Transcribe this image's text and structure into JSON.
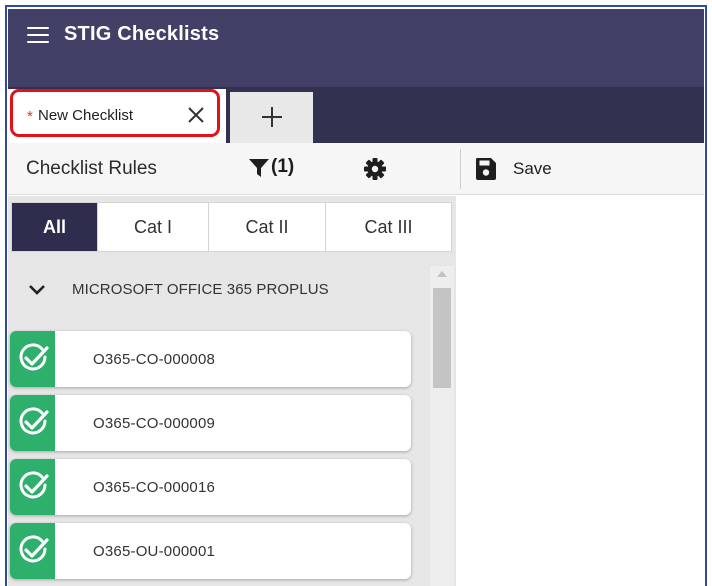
{
  "header": {
    "title": "STIG Checklists",
    "menu_icon": "hamburger-menu-icon",
    "background": "#434068"
  },
  "tabs": {
    "active": {
      "modified_marker": "*",
      "label": "New Checklist",
      "close_icon": "close-icon"
    },
    "add_icon": "plus-icon"
  },
  "toolbar": {
    "title": "Checklist Rules",
    "filter_icon": "filter-icon",
    "filter_count": "(1)",
    "settings_icon": "gear-icon",
    "save_icon": "floppy-disk-icon",
    "save_label": "Save"
  },
  "category_tabs": [
    {
      "label": "All",
      "active": true
    },
    {
      "label": "Cat I",
      "active": false
    },
    {
      "label": "Cat II",
      "active": false
    },
    {
      "label": "Cat III",
      "active": false
    }
  ],
  "group": {
    "label": "MICROSOFT OFFICE 365 PROPLUS",
    "expand_icon": "chevron-down-icon"
  },
  "rules": [
    {
      "id": "O365-CO-000008",
      "status_icon": "check-circle-icon",
      "status_color": "#2eb06c"
    },
    {
      "id": "O365-CO-000009",
      "status_icon": "check-circle-icon",
      "status_color": "#2eb06c"
    },
    {
      "id": "O365-CO-000016",
      "status_icon": "check-circle-icon",
      "status_color": "#2eb06c"
    },
    {
      "id": "O365-OU-000001",
      "status_icon": "check-circle-icon",
      "status_color": "#2eb06c"
    }
  ],
  "colors": {
    "accent": "#2f2d4d",
    "tab_strip": "#333150",
    "highlight_border": "#e2111a",
    "status_pass": "#2eb06c"
  }
}
